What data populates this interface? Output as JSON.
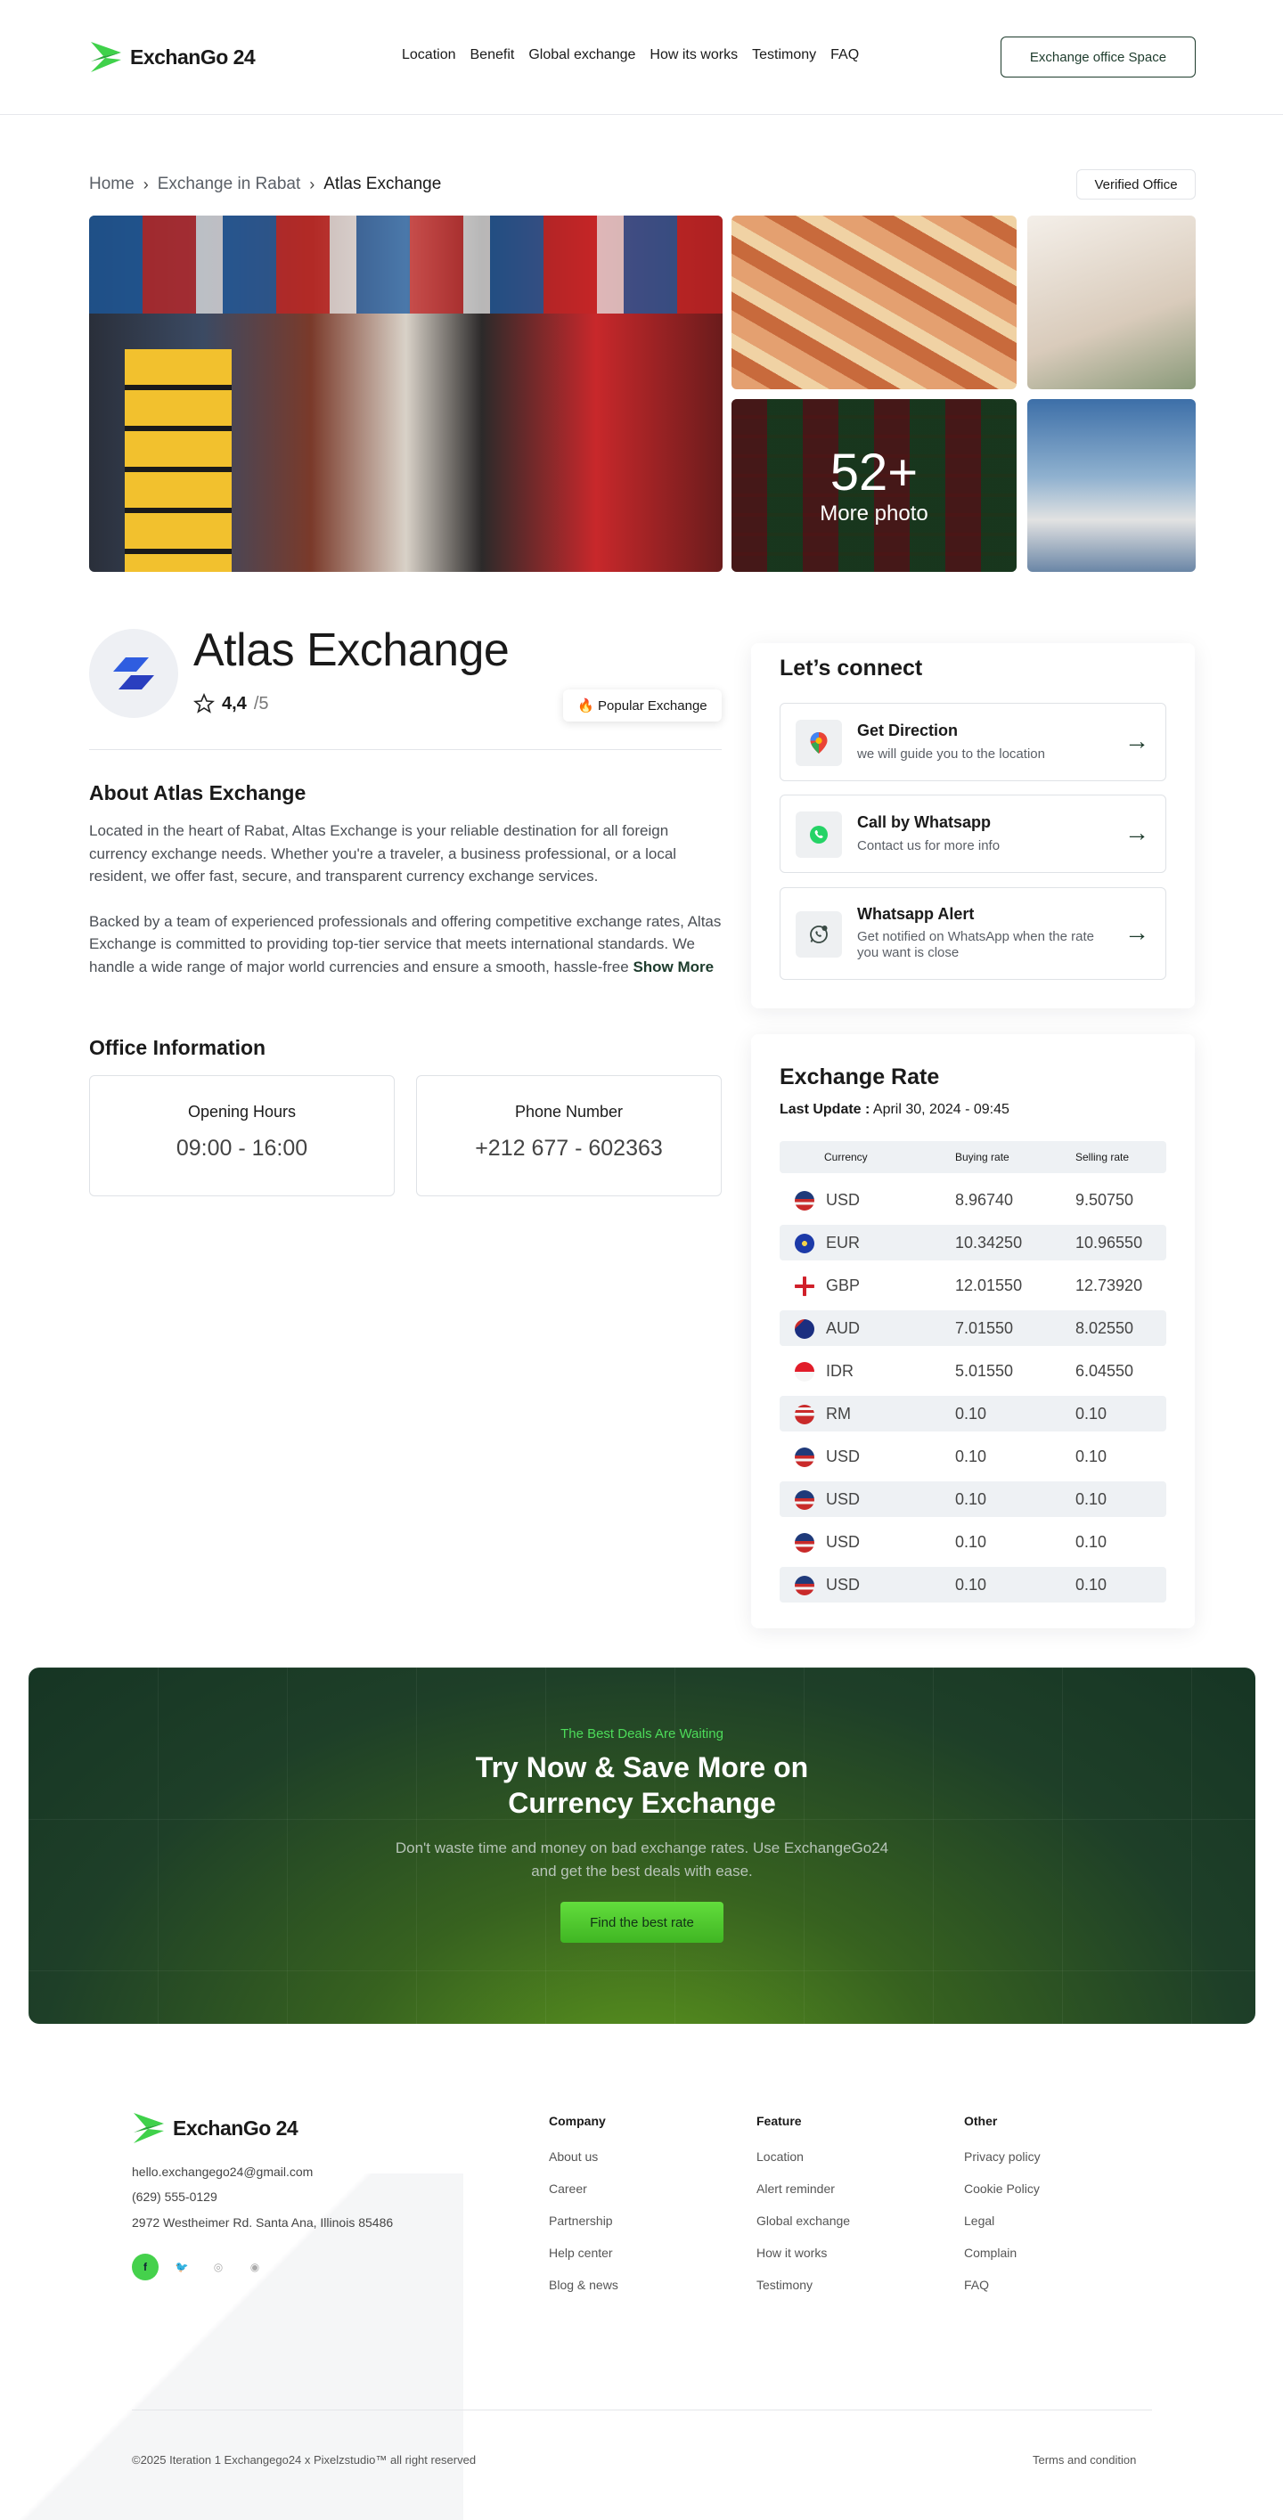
{
  "brand": {
    "name": "ExchanGo 24",
    "green": "#3fd14a",
    "dark": "#1d3b2c"
  },
  "nav": {
    "items": [
      "Location",
      "Benefit",
      "Global exchange",
      "How its works",
      "Testimony",
      "FAQ"
    ],
    "cta": "Exchange office Space"
  },
  "breadcrumb": {
    "items": [
      "Home",
      "Exchange in Rabat",
      "Atlas Exchange"
    ],
    "badge": "Verified Office"
  },
  "gallery": {
    "more_count": "52+",
    "more_label": "More photo"
  },
  "office": {
    "name": "Atlas Exchange",
    "rating": "4,4",
    "rating_max": "/5",
    "popular_badge": "Popular Exchange",
    "about_title": "About Atlas Exchange",
    "about_p1": "Located in the heart of Rabat, Altas Exchange is your reliable destination for all foreign currency exchange needs. Whether you're a traveler, a business professional, or a local resident, we offer fast, secure, and transparent currency exchange services.",
    "about_p2": "Backed by a team of experienced professionals and offering competitive exchange rates, Altas Exchange is committed to providing top-tier service that meets international standards. We handle a wide range of major world currencies and ensure a smooth, hassle-free",
    "show_more": "Show More",
    "info_title": "Office Information",
    "hours_label": "Opening Hours",
    "hours_value": "09:00 - 16:00",
    "phone_label": "Phone Number",
    "phone_value": "+212 677 - 602363"
  },
  "connect": {
    "title": "Let’s connect",
    "items": [
      {
        "title": "Get Direction",
        "desc": "we will guide you to the location"
      },
      {
        "title": "Call by Whatsapp",
        "desc": "Contact us for more info"
      },
      {
        "title": "Whatsapp Alert",
        "desc": "Get notified on WhatsApp when the rate you want is close"
      }
    ]
  },
  "rates": {
    "title": "Exchange Rate",
    "last_update_label": "Last Update :",
    "last_update_value": "April 30, 2024 - 09:45",
    "headers": [
      "Currency",
      "Buying rate",
      "Selling rate"
    ],
    "rows": [
      {
        "code": "USD",
        "buy": "8.96740",
        "sell": "9.50750"
      },
      {
        "code": "EUR",
        "buy": "10.34250",
        "sell": "10.96550"
      },
      {
        "code": "GBP",
        "buy": "12.01550",
        "sell": "12.73920"
      },
      {
        "code": "AUD",
        "buy": "7.01550",
        "sell": "8.02550"
      },
      {
        "code": "IDR",
        "buy": "5.01550",
        "sell": "6.04550"
      },
      {
        "code": "RM",
        "buy": "0.10",
        "sell": "0.10"
      },
      {
        "code": "USD",
        "buy": "0.10",
        "sell": "0.10"
      },
      {
        "code": "USD",
        "buy": "0.10",
        "sell": "0.10"
      },
      {
        "code": "USD",
        "buy": "0.10",
        "sell": "0.10"
      },
      {
        "code": "USD",
        "buy": "0.10",
        "sell": "0.10"
      }
    ]
  },
  "cta": {
    "tag": "The Best Deals Are Waiting",
    "head1": "Try Now & Save More on",
    "head2": "Currency Exchange",
    "sub1": "Don't waste time and money on bad exchange rates. Use ExchangeGo24",
    "sub2": "and get the best deals with ease.",
    "button": "Find the best rate"
  },
  "footer": {
    "email": "hello.exchangego24@gmail.com",
    "phone": "(629) 555-0129",
    "address": "2972 Westheimer Rd. Santa Ana, Illinois 85486",
    "columns": [
      {
        "title": "Company",
        "links": [
          "About us",
          "Career",
          "Partnership",
          "Help center",
          "Blog & news"
        ]
      },
      {
        "title": "Feature",
        "links": [
          "Location",
          "Alert reminder",
          "Global exchange",
          "How it works",
          "Testimony"
        ]
      },
      {
        "title": "Other",
        "links": [
          "Privacy policy",
          "Cookie Policy",
          "Legal",
          "Complain",
          "FAQ"
        ]
      }
    ],
    "copyright": "©2025 Iteration 1 Exchangego24 x Pixelzstudio™ all right reserved",
    "terms": "Terms and condition"
  }
}
